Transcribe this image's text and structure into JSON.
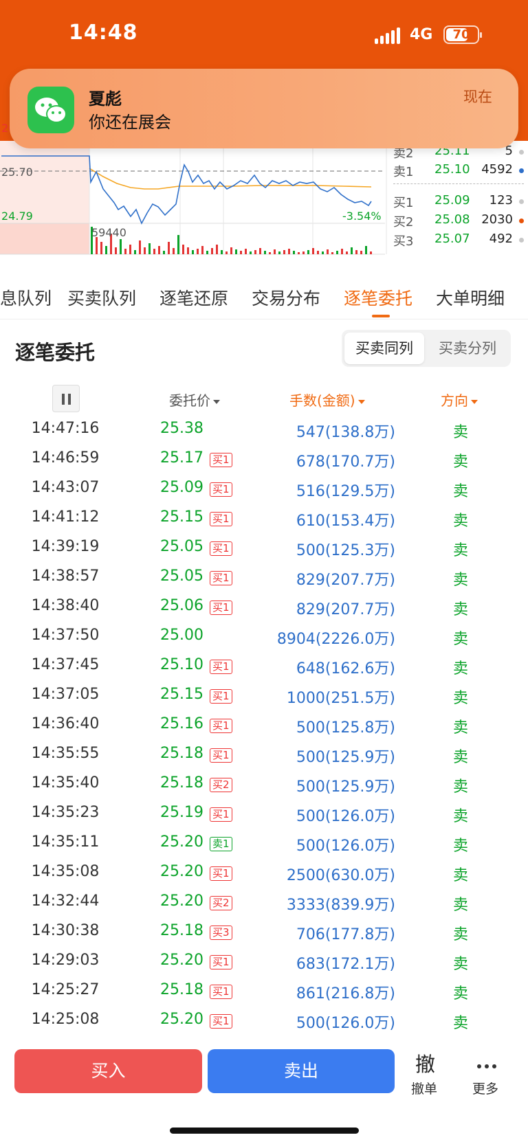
{
  "status_bar": {
    "time": "14:48",
    "network": "4G",
    "battery": "70",
    "battery_level_percent": 70
  },
  "notification": {
    "app_icon": "wechat-icon",
    "sender": "夏彪",
    "message": "你还在展会",
    "time": "现在"
  },
  "chart": {
    "price_top_label": "26",
    "ref_price": "25.70",
    "low_price": "24.79",
    "change_pct": "-3.54%",
    "volume_label": "59440",
    "colors": {
      "up": "#E33333",
      "down": "#0BA329",
      "price_line": "#2E6FC9",
      "avg_line": "#F5A623"
    }
  },
  "order_book": {
    "asks": [
      {
        "label": "卖2",
        "price": "25.11",
        "qty": "5",
        "dot": "#C8C8C8"
      },
      {
        "label": "卖1",
        "price": "25.10",
        "qty": "4592",
        "dot": "#2E6FC9"
      }
    ],
    "bids": [
      {
        "label": "买1",
        "price": "25.09",
        "qty": "123",
        "dot": "#C8C8C8"
      },
      {
        "label": "买2",
        "price": "25.08",
        "qty": "2030",
        "dot": "#E8530A"
      },
      {
        "label": "买3",
        "price": "25.07",
        "qty": "492",
        "dot": "#C8C8C8"
      }
    ]
  },
  "tabs": [
    "息队列",
    "买卖队列",
    "逐笔还原",
    "交易分布",
    "逐笔委托",
    "大单明细"
  ],
  "active_tab": "逐笔委托",
  "section": {
    "title": "逐笔委托",
    "toggle": [
      "买卖同列",
      "买卖分列"
    ],
    "toggle_selected": "买卖同列"
  },
  "columns": {
    "price": "委托价",
    "volume": "手数(金额)",
    "direction": "方向"
  },
  "rows": [
    {
      "time": "14:47:16",
      "price": "25.38",
      "tag": "",
      "tag_type": "",
      "volume": "547(138.8万)",
      "dir": "卖"
    },
    {
      "time": "14:46:59",
      "price": "25.17",
      "tag": "买1",
      "tag_type": "buy",
      "volume": "678(170.7万)",
      "dir": "卖"
    },
    {
      "time": "14:43:07",
      "price": "25.09",
      "tag": "买1",
      "tag_type": "buy",
      "volume": "516(129.5万)",
      "dir": "卖"
    },
    {
      "time": "14:41:12",
      "price": "25.15",
      "tag": "买1",
      "tag_type": "buy",
      "volume": "610(153.4万)",
      "dir": "卖"
    },
    {
      "time": "14:39:19",
      "price": "25.05",
      "tag": "买1",
      "tag_type": "buy",
      "volume": "500(125.3万)",
      "dir": "卖"
    },
    {
      "time": "14:38:57",
      "price": "25.05",
      "tag": "买1",
      "tag_type": "buy",
      "volume": "829(207.7万)",
      "dir": "卖"
    },
    {
      "time": "14:38:40",
      "price": "25.06",
      "tag": "买1",
      "tag_type": "buy",
      "volume": "829(207.7万)",
      "dir": "卖"
    },
    {
      "time": "14:37:50",
      "price": "25.00",
      "tag": "",
      "tag_type": "",
      "volume": "8904(2226.0万)",
      "dir": "卖"
    },
    {
      "time": "14:37:45",
      "price": "25.10",
      "tag": "买1",
      "tag_type": "buy",
      "volume": "648(162.6万)",
      "dir": "卖"
    },
    {
      "time": "14:37:05",
      "price": "25.15",
      "tag": "买1",
      "tag_type": "buy",
      "volume": "1000(251.5万)",
      "dir": "卖"
    },
    {
      "time": "14:36:40",
      "price": "25.16",
      "tag": "买1",
      "tag_type": "buy",
      "volume": "500(125.8万)",
      "dir": "卖"
    },
    {
      "time": "14:35:55",
      "price": "25.18",
      "tag": "买1",
      "tag_type": "buy",
      "volume": "500(125.9万)",
      "dir": "卖"
    },
    {
      "time": "14:35:40",
      "price": "25.18",
      "tag": "买2",
      "tag_type": "buy",
      "volume": "500(125.9万)",
      "dir": "卖"
    },
    {
      "time": "14:35:23",
      "price": "25.19",
      "tag": "买1",
      "tag_type": "buy",
      "volume": "500(126.0万)",
      "dir": "卖"
    },
    {
      "time": "14:35:11",
      "price": "25.20",
      "tag": "卖1",
      "tag_type": "sell",
      "volume": "500(126.0万)",
      "dir": "卖"
    },
    {
      "time": "14:35:08",
      "price": "25.20",
      "tag": "买1",
      "tag_type": "buy",
      "volume": "2500(630.0万)",
      "dir": "卖"
    },
    {
      "time": "14:32:44",
      "price": "25.20",
      "tag": "买2",
      "tag_type": "buy",
      "volume": "3333(839.9万)",
      "dir": "卖"
    },
    {
      "time": "14:30:38",
      "price": "25.18",
      "tag": "买3",
      "tag_type": "buy",
      "volume": "706(177.8万)",
      "dir": "卖"
    },
    {
      "time": "14:29:03",
      "price": "25.20",
      "tag": "买1",
      "tag_type": "buy",
      "volume": "683(172.1万)",
      "dir": "卖"
    },
    {
      "time": "14:25:27",
      "price": "25.18",
      "tag": "买1",
      "tag_type": "buy",
      "volume": "861(216.8万)",
      "dir": "卖"
    },
    {
      "time": "14:25:08",
      "price": "25.20",
      "tag": "买1",
      "tag_type": "buy",
      "volume": "500(126.0万)",
      "dir": "卖"
    }
  ],
  "bottom": {
    "buy": "买入",
    "sell": "卖出",
    "cancel_icon": "撤",
    "cancel": "撤单",
    "more": "更多"
  }
}
